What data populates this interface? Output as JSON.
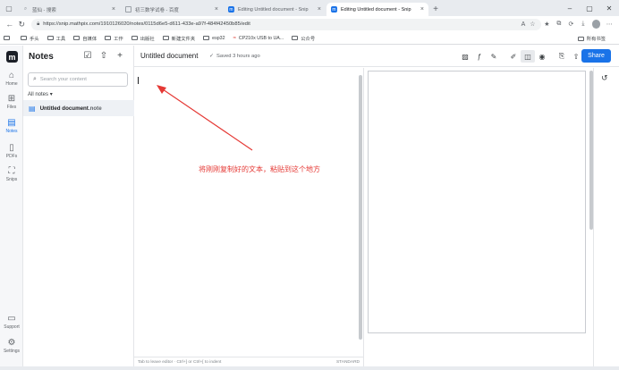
{
  "browser": {
    "tabs": [
      {
        "label": "蓝仙 - 搜索",
        "active": false
      },
      {
        "label": "初三数学试卷 - 百度",
        "active": false
      },
      {
        "label": "Editing Untitled document - Snip",
        "active": false
      },
      {
        "label": "Editing Untitled document - Snip",
        "active": true
      }
    ],
    "url": "https://snip.mathpix.com/1910126020/notes/0115d6e5-d611-433e-a97f-484f42450b85/edit",
    "bookmarks": [
      "手头",
      "工具",
      "自媒体",
      "工作",
      "出版社",
      "新建文件夹",
      "esp32",
      "CP210x USB to UA...",
      "公众号"
    ],
    "bookmark_right": "所有书签"
  },
  "rail": {
    "logo": "m",
    "items": [
      {
        "label": "Home",
        "icon": "home-icon"
      },
      {
        "label": "Files",
        "icon": "files-icon"
      },
      {
        "label": "Notes",
        "icon": "notes-icon"
      },
      {
        "label": "PDFs",
        "icon": "pdf-icon"
      },
      {
        "label": "Snips",
        "icon": "snip-icon"
      }
    ],
    "bottom": [
      {
        "label": "Support",
        "icon": "support-icon"
      },
      {
        "label": "Settings",
        "icon": "gear-icon"
      }
    ]
  },
  "notes_panel": {
    "title": "Notes",
    "search_placeholder": "Search your content",
    "filter": "All notes",
    "note_name": "Untitled document",
    "note_ext": ".note"
  },
  "editor": {
    "doc_title": "Untitled document",
    "saved_status": "Saved 3 hours ago",
    "share_label": "Share",
    "footer_hint": "Tab to leave editor · Ctrl+] or Ctrl+[ to indent",
    "footer_mode": "STANDARD"
  },
  "annotation": {
    "text": "将刚刚复制好的文本，粘贴到这个地方",
    "color": "#e53935"
  },
  "colors": {
    "accent": "#1a73e8"
  }
}
